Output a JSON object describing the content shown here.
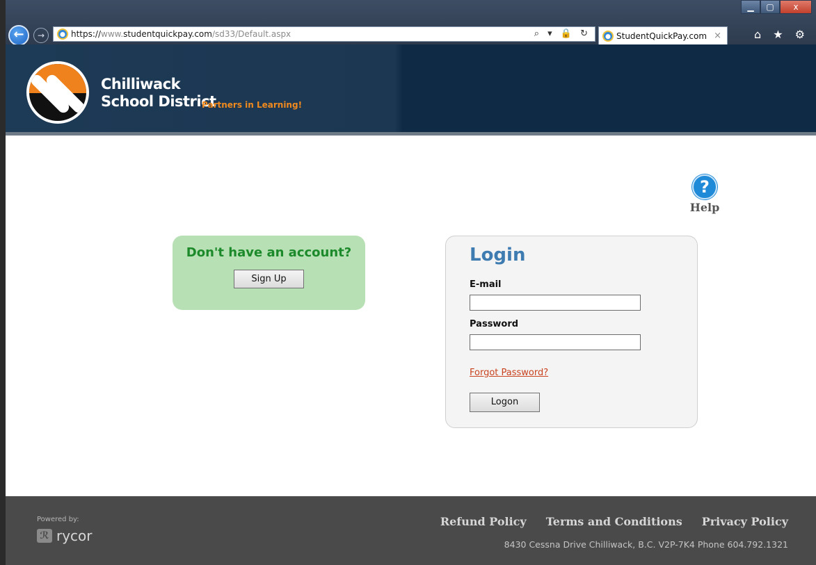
{
  "browser": {
    "url_prefix": "https://",
    "url_host": "www.",
    "url_domain": "studentquickpay.com",
    "url_path": "/sd33/Default.aspx",
    "addr_tools": "⌕ ▾ 🔒 ↻",
    "tab_title": "StudentQuickPay.com",
    "tab_close": "×",
    "window_minimize": "▁",
    "window_maximize": "▢",
    "window_close": "x",
    "toolbar_icons": "⌂ ★ ⚙"
  },
  "header": {
    "brand_line1": "Chilliwack",
    "brand_line2": "School District",
    "tagline": "Partners in Learning!"
  },
  "help": {
    "icon": "?",
    "label": "Help"
  },
  "signup": {
    "title": "Don't have an account?",
    "button": "Sign Up"
  },
  "login": {
    "title": "Login",
    "email_label": "E-mail",
    "email_value": "",
    "password_label": "Password",
    "password_value": "",
    "forgot": "Forgot Password?",
    "button": "Logon"
  },
  "footer": {
    "powered_by": "Powered by:",
    "powered_brand": "rycor",
    "links": [
      "Refund Policy",
      "Terms and Conditions",
      "Privacy Policy"
    ],
    "address": "8430 Cessna Drive Chilliwack, B.C. V2P-7K4 Phone 604.792.1321"
  },
  "colors": {
    "header_bg": "#1d3a56",
    "accent_orange": "#f08a1e",
    "login_title": "#3d7bb1",
    "signup_bg": "#b7e0b4",
    "signup_title": "#1c8a2a",
    "forgot_link": "#c8421e",
    "footer_bg": "#4a4a4a"
  }
}
